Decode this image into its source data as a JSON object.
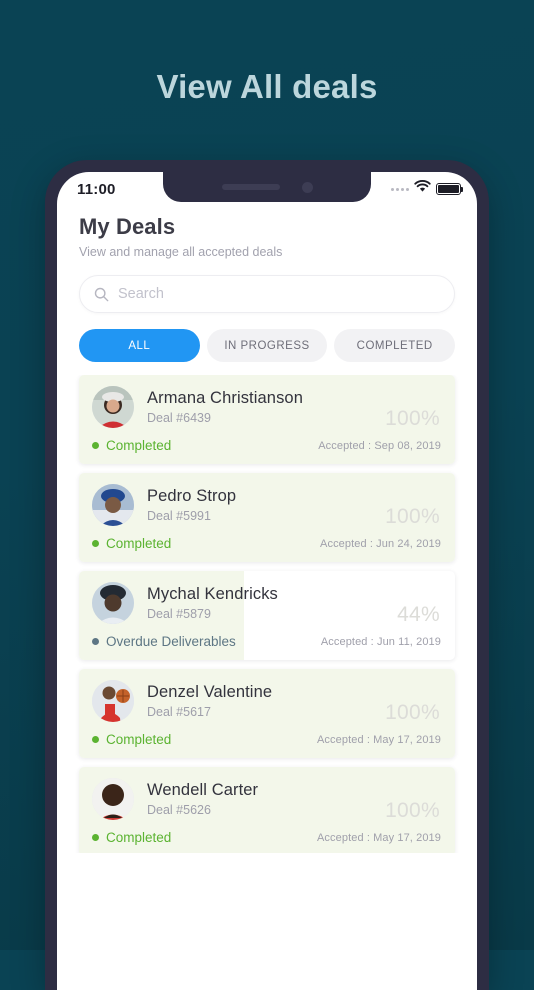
{
  "headline": "View All deals",
  "theme": {
    "background_top": "#0a4354",
    "background_bottom": "#093a48",
    "headline_color": "#bcd6dc",
    "phone_frame": "#2d2d43",
    "accent_blue": "#2196f3",
    "completed_green": "#5bb331",
    "overdue_slate": "#5d7684",
    "card_fill": "#f3f7ea"
  },
  "status_bar": {
    "time": "11:00",
    "signal_icon": "signal-dots-icon",
    "wifi_icon": "wifi-icon",
    "battery_icon": "battery-full-icon"
  },
  "header": {
    "title": "My Deals",
    "subtitle": "View and manage all accepted deals"
  },
  "search": {
    "icon": "search-icon",
    "placeholder": "Search",
    "value": ""
  },
  "tabs": [
    {
      "label": "ALL",
      "active": true
    },
    {
      "label": "IN PROGRESS",
      "active": false
    },
    {
      "label": "COMPLETED",
      "active": false
    }
  ],
  "deals": [
    {
      "name": "Armana Christianson",
      "deal_id": "Deal #6439",
      "percent": "100%",
      "progress": 100,
      "status": "Completed",
      "status_type": "completed",
      "accepted": "Accepted : Sep 08, 2019",
      "avatar": "avatar-armana-christianson"
    },
    {
      "name": "Pedro Strop",
      "deal_id": "Deal #5991",
      "percent": "100%",
      "progress": 100,
      "status": "Completed",
      "status_type": "completed",
      "accepted": "Accepted : Jun 24, 2019",
      "avatar": "avatar-pedro-strop"
    },
    {
      "name": "Mychal Kendricks",
      "deal_id": "Deal #5879",
      "percent": "44%",
      "progress": 44,
      "status": "Overdue Deliverables",
      "status_type": "overdue",
      "accepted": "Accepted : Jun 11, 2019",
      "avatar": "avatar-mychal-kendricks"
    },
    {
      "name": "Denzel Valentine",
      "deal_id": "Deal #5617",
      "percent": "100%",
      "progress": 100,
      "status": "Completed",
      "status_type": "completed",
      "accepted": "Accepted : May 17, 2019",
      "avatar": "avatar-denzel-valentine"
    },
    {
      "name": "Wendell Carter",
      "deal_id": "Deal #5626",
      "percent": "100%",
      "progress": 100,
      "status": "Completed",
      "status_type": "completed",
      "accepted": "Accepted : May 17, 2019",
      "avatar": "avatar-wendell-carter"
    }
  ]
}
